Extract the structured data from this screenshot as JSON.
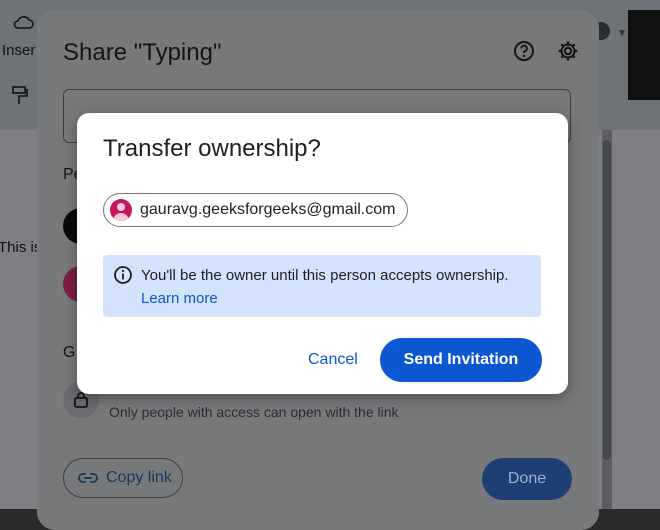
{
  "background": {
    "toolbar_insert_label": "Inser",
    "doc_text": "This is"
  },
  "share_dialog": {
    "title": "Share \"Typing\"",
    "people_label": "Pe",
    "general_access_label": "G",
    "access_note": "Only people with access can open with the link",
    "copy_link_label": "Copy link",
    "done_label": "Done"
  },
  "transfer_modal": {
    "title": "Transfer ownership?",
    "email": "gauravg.geeksforgeeks@gmail.com",
    "info_text": "You'll be the owner until this person accepts ownership.",
    "learn_more": "Learn more",
    "cancel_label": "Cancel",
    "send_label": "Send Invitation"
  },
  "colors": {
    "primary": "#0b57d0",
    "info_bg": "#d3e3fd"
  }
}
